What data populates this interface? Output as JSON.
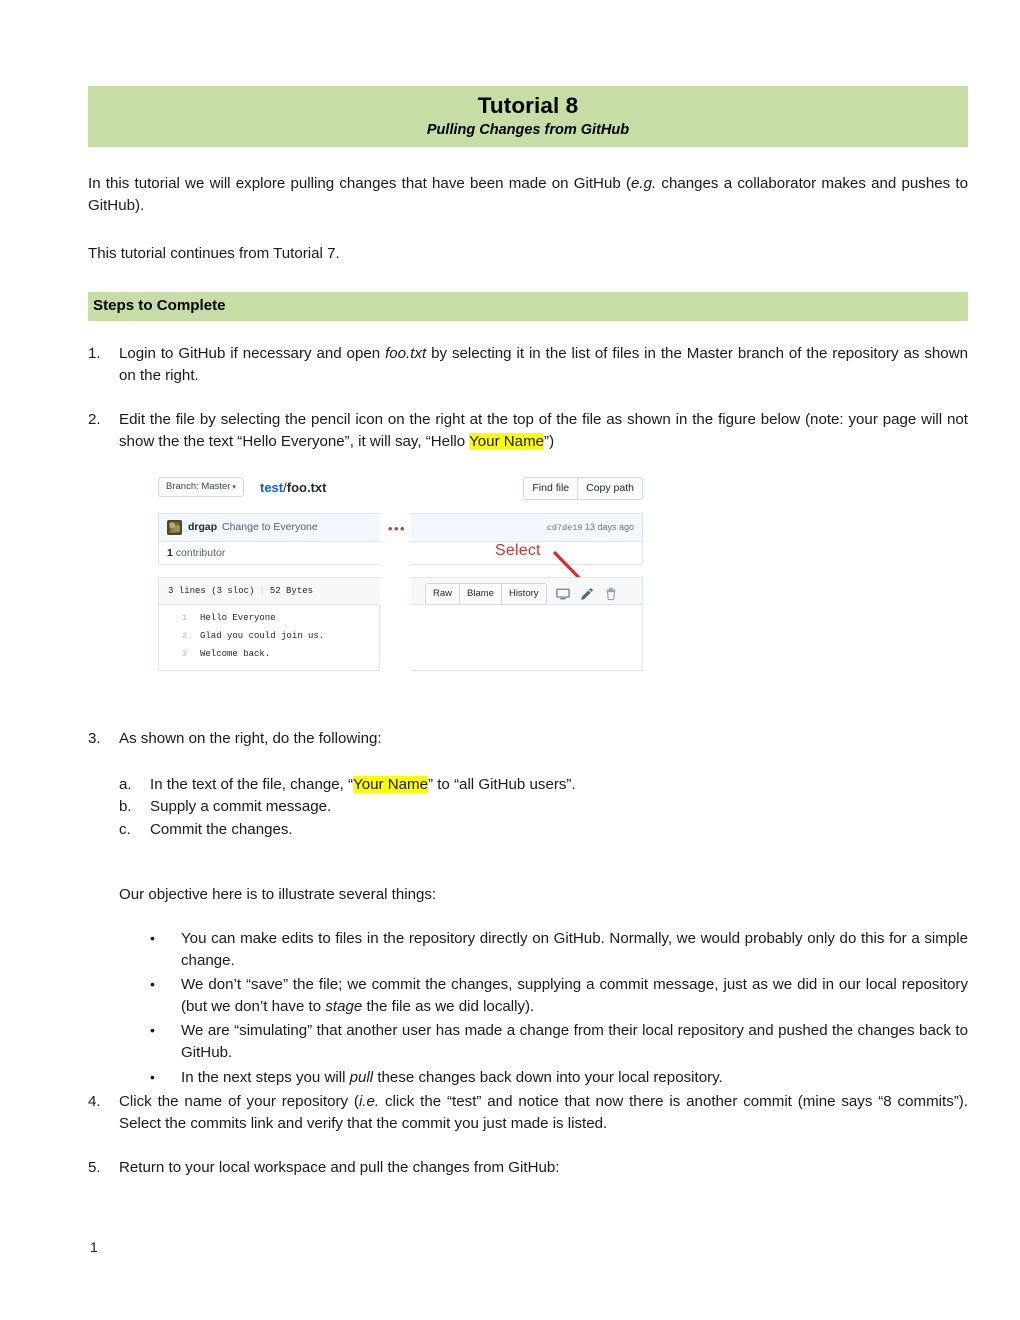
{
  "document": {
    "title": "Tutorial 8",
    "subtitle": "Pulling Changes from GitHub",
    "page_number": "1",
    "banner_color": "#C6DDA6",
    "highlight_color": "#FFFF00"
  },
  "intro": {
    "p1_a": "In this tutorial we will explore pulling changes that have been made on GitHub (",
    "p1_em": "e.g.",
    "p1_b": " changes a collaborator makes and pushes to GitHub).",
    "p2": "This tutorial continues from Tutorial 7."
  },
  "section": {
    "label": "Steps to Complete"
  },
  "steps": {
    "s1": {
      "num": "1.",
      "a": "Login to GitHub if necessary and open ",
      "em": "foo.txt",
      "b": " by selecting it in the list of files in the Master branch of the repository as shown on the right."
    },
    "s2": {
      "num": "2.",
      "a": "Edit the file by selecting the pencil icon on the right at the top of the file as shown in the figure below (note: your page will not show the the text “Hello Everyone”, it will say, “Hello ",
      "hl": "Your Name",
      "b": "”)"
    },
    "s3": {
      "num": "3.",
      "text": "As shown on the right, do the following:",
      "sub": [
        {
          "marker": "a.",
          "a": "In the text of the file, change, “",
          "hl": "Your Name",
          "b": "” to “all GitHub users”."
        },
        {
          "marker": "b.",
          "a": "Supply a commit message.",
          "hl": "",
          "b": ""
        },
        {
          "marker": "c.",
          "a": "Commit the changes.",
          "hl": "",
          "b": ""
        }
      ]
    },
    "objective": "Our objective here is to illustrate several things:",
    "bullets": [
      {
        "a": "You can make edits to files in the repository directly on GitHub. Normally, we would probably only do this for a simple change.",
        "em": "",
        "b": ""
      },
      {
        "a": "We don’t “save” the file; we commit the changes, supplying a commit message, just as we did in our local repository (but we don’t have to ",
        "em": "stage",
        "b": " the file as we did locally)."
      },
      {
        "a": "We are “simulating” that another user has made a change from their local repository and pushed the changes back to GitHub.",
        "em": "",
        "b": ""
      },
      {
        "a": "In the next steps you will ",
        "em": "pull",
        "b": " these changes back down into your local repository."
      }
    ],
    "s4": {
      "num": "4.",
      "a": "Click the name of your repository (",
      "em": "i.e.",
      "b": " click the “test” and notice that now there is another commit (mine says “8 commits”). Select the commits link and verify that the commit you just made is listed."
    },
    "s5": {
      "num": "5.",
      "text": "Return to your local workspace and pull the changes from GitHub:"
    }
  },
  "figure": {
    "branch_button": "Branch: Master",
    "branch_caret": "▾",
    "breadcrumb_repo": "test",
    "breadcrumb_sep": "/",
    "breadcrumb_file": "foo.txt",
    "find_file": "Find file",
    "copy_path": "Copy path",
    "commit_user": "drgap",
    "commit_message": "Change to Everyone",
    "commit_sha": "cd7de19",
    "commit_time": "13 days ago",
    "ellipsis": "•••",
    "contributors_count": "1",
    "contributors_label": " contributor",
    "file_lines": "3 lines (3 sloc)",
    "file_size": "52 Bytes",
    "action_raw": "Raw",
    "action_blame": "Blame",
    "action_history": "History",
    "annotation": "Select",
    "annotation_color": "#D0332E",
    "code": [
      {
        "n": "1",
        "text": "Hello Everyone"
      },
      {
        "n": "2",
        "text": "Glad you could join us."
      },
      {
        "n": "3",
        "text": "Welcome back."
      }
    ]
  }
}
